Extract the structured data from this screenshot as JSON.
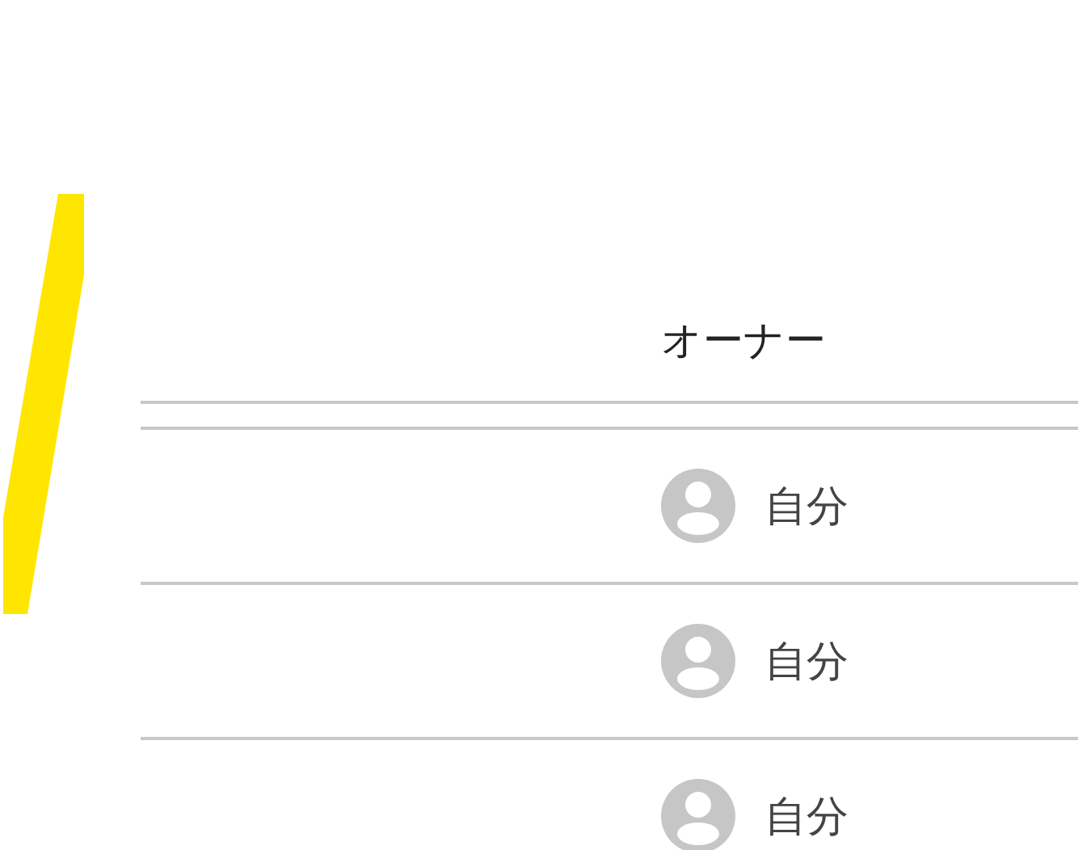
{
  "table": {
    "columns": [
      {
        "label": "オーナー"
      }
    ],
    "rows": [
      {
        "owner": "自分"
      },
      {
        "owner": "自分"
      },
      {
        "owner": "自分"
      }
    ]
  }
}
